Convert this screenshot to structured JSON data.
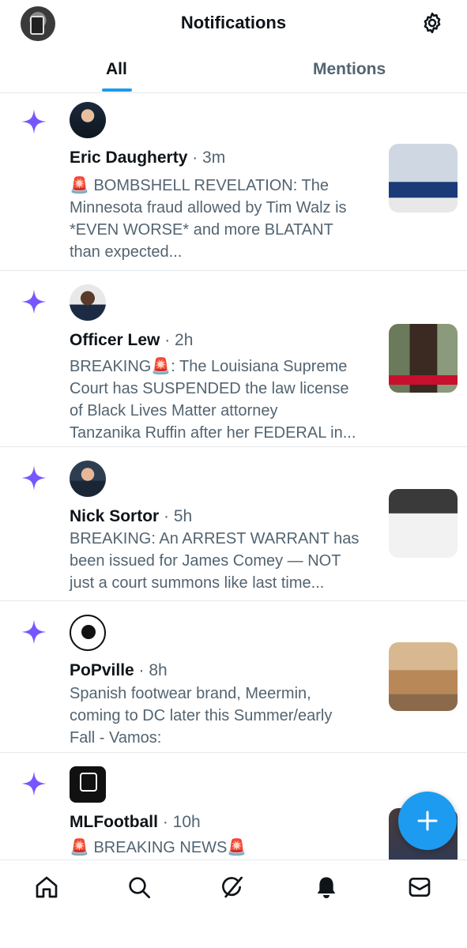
{
  "header": {
    "title": "Notifications"
  },
  "tabs": [
    {
      "label": "All",
      "active": true
    },
    {
      "label": "Mentions",
      "active": false
    }
  ],
  "notifications": [
    {
      "name": "Eric Daugherty",
      "time": "· 3m",
      "lines": [
        "🚨 BOMBSHELL REVELATION: The",
        "Minnesota fraud allowed by Tim Walz is",
        "*EVEN WORSE* and more BLATANT",
        "than expected..."
      ]
    },
    {
      "name": "Officer Lew",
      "time": "· 2h",
      "lines": [
        "BREAKING🚨: The Louisiana Supreme",
        "Court has SUSPENDED the law license",
        "of Black Lives Matter attorney",
        "Tanzanika Ruffin after her FEDERAL in..."
      ]
    },
    {
      "name": "Nick Sortor",
      "time": "· 5h",
      "lines": [
        "BREAKING: An ARREST WARRANT has",
        "been issued for James Comey — NOT",
        "just a court summons like last time..."
      ]
    },
    {
      "name": "PoPville",
      "time": "· 8h",
      "lines": [
        "Spanish footwear brand, Meermin,",
        "coming to DC later this Summer/early",
        "Fall - Vamos:"
      ]
    },
    {
      "name": "MLFootball",
      "time": "· 10h",
      "lines": [
        "🚨 BREAKING NEWS🚨"
      ]
    }
  ],
  "colors": {
    "accent": "#1d9bf0",
    "spark": "#7856ff",
    "muted": "#536471",
    "text": "#0f1419"
  },
  "icons": {
    "settings": "gear-icon",
    "spark": "sparkle-icon",
    "compose": "plus-icon",
    "nav": [
      "home-icon",
      "search-icon",
      "grok-icon",
      "bell-icon",
      "mail-icon"
    ]
  }
}
